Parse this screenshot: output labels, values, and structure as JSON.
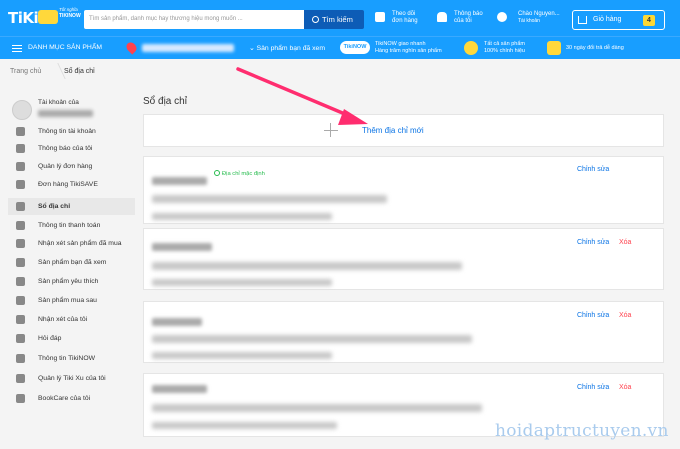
{
  "header": {
    "logo": "TiKi",
    "logo_sub_1": "Tốt nghĩa",
    "logo_sub_2": "TIKINOW",
    "search_placeholder": "Tìm sản phẩm, danh mục hay thương hiệu mong muốn ...",
    "search_button": "Tìm kiếm",
    "track_1": "Theo dõi",
    "track_2": "đơn hàng",
    "notif_1": "Thông báo",
    "notif_2": "của tôi",
    "greet": "Chào Nguyen...",
    "account": "Tài khoản",
    "cart_label": "Giỏ hàng",
    "cart_count": "4"
  },
  "subnav": {
    "categories": "DANH MỤC SẢN PHẨM",
    "viewed": "Sản phẩm bạn đã xem",
    "tikinow_badge": "TikiNOW",
    "tikinow_1": "TikiNOW giao nhanh",
    "tikinow_2": "Hàng trăm nghìn sản phẩm",
    "genuine_1": "Tất cả sản phẩm",
    "genuine_2": "100% chính hiệu",
    "return": "30 ngày đổi trả dễ dàng"
  },
  "breadcrumb": {
    "home": "Trang chủ",
    "current": "Sổ địa chỉ"
  },
  "sidebar": {
    "account_label": "Tài khoản của",
    "items": [
      {
        "label": "Thông tin tài khoản",
        "icon": "user-icon"
      },
      {
        "label": "Thông báo của tôi",
        "icon": "bell-icon"
      },
      {
        "label": "Quản lý đơn hàng",
        "icon": "list-icon"
      },
      {
        "label": "Đơn hàng TikiSAVE",
        "icon": "tikisave-icon"
      },
      {
        "label": "Sổ địa chỉ",
        "icon": "map-pin-icon"
      },
      {
        "label": "Thông tin thanh toán",
        "icon": "card-icon"
      },
      {
        "label": "Nhận xét sản phẩm đã mua",
        "icon": "edit-icon"
      },
      {
        "label": "Sản phẩm bạn đã xem",
        "icon": "eye-icon"
      },
      {
        "label": "Sản phẩm yêu thích",
        "icon": "heart-icon"
      },
      {
        "label": "Sản phẩm mua sau",
        "icon": "bookmark-icon"
      },
      {
        "label": "Nhận xét của tôi",
        "icon": "star-icon"
      },
      {
        "label": "Hỏi đáp",
        "icon": "chat-icon"
      },
      {
        "label": "Thông tin TikiNOW",
        "icon": "tikinow-icon"
      },
      {
        "label": "Quản lý Tiki Xu của tôi",
        "icon": "coin-icon"
      },
      {
        "label": "BookCare của tôi",
        "icon": "book-icon"
      }
    ],
    "active_index": 4
  },
  "main": {
    "title": "Sổ địa chỉ",
    "add_label": "Thêm địa chỉ mới",
    "default_label": "Địa chỉ mặc định",
    "edit_label": "Chỉnh sửa",
    "delete_label": "Xóa"
  },
  "watermark": "hoidaptructuyen.vn",
  "colors": {
    "brand": "#189eff",
    "link": "#0b74e5",
    "delete": "#ff424e",
    "default": "#26bc4e",
    "arrow": "#ff2d6f"
  }
}
